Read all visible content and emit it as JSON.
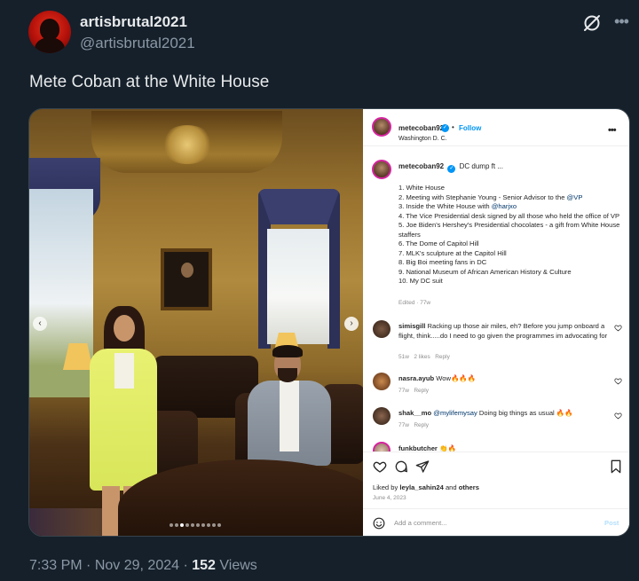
{
  "tweet": {
    "display_name": "artisbrutal2021",
    "handle": "@artisbrutal2021",
    "text": "Mete Coban at the White House",
    "time": "7:33 PM",
    "separator": "·",
    "date": "Nov 29, 2024",
    "views_count": "152",
    "views_label": "Views"
  },
  "instagram": {
    "username": "metecoban92",
    "follow_label": "Follow",
    "dot": "•",
    "location": "Washington D. C.",
    "caption_lead": "DC dump ft ...",
    "caption_items": [
      "1. White House",
      "2. Meeting with Stephanie Young - Senior Advisor to the ",
      "3. Inside the White House with ",
      "4. The Vice Presidential desk signed by all those who held the office of VP",
      "5. Joe Biden's Hershey's Presidential chocolates - a gift from White House staffers",
      "6. The Dome of Capitol Hill",
      "7. MLK's sculpture at the Capitol Hill",
      "8. Big Boi meeting fans in DC",
      "9. National Museum of African American History & Culture",
      "10. My DC suit"
    ],
    "mention_vp": "@VP",
    "mention_harjxo": "@harjxo",
    "edited": "Edited · 77w",
    "comments": [
      {
        "user": "simisgill",
        "text": "Racking up those air miles, eh? Before you jump onboard a flight, think.....do I need to go given the programmes im advocating for",
        "age": "51w",
        "likes": "2 likes",
        "reply": "Reply"
      },
      {
        "user": "nasra.ayub",
        "text": "Wow🔥🔥🔥",
        "age": "77w",
        "reply": "Reply"
      },
      {
        "user": "shak__mo",
        "mention": "@mylifemysay",
        "text": "Doing big things as usual 🔥🔥",
        "age": "77w",
        "reply": "Reply"
      },
      {
        "user": "funkbutcher",
        "text": "👏🔥"
      }
    ],
    "liked_by_prefix": "Liked by",
    "liked_by_user": "leyla_sahin24",
    "liked_by_and": "and",
    "liked_by_others": "others",
    "post_date": "June 4, 2023",
    "add_comment_placeholder": "Add a comment...",
    "post_label": "Post"
  },
  "colors": {
    "background": "#15202b",
    "text_primary": "#e7e9ea",
    "text_secondary": "#8b98a5",
    "instagram_blue": "#0095f6"
  },
  "icons": {
    "grok": "grok-icon",
    "more": "more-icon",
    "heart": "heart-icon",
    "comment": "comment-icon",
    "share": "share-icon",
    "save": "bookmark-icon"
  }
}
